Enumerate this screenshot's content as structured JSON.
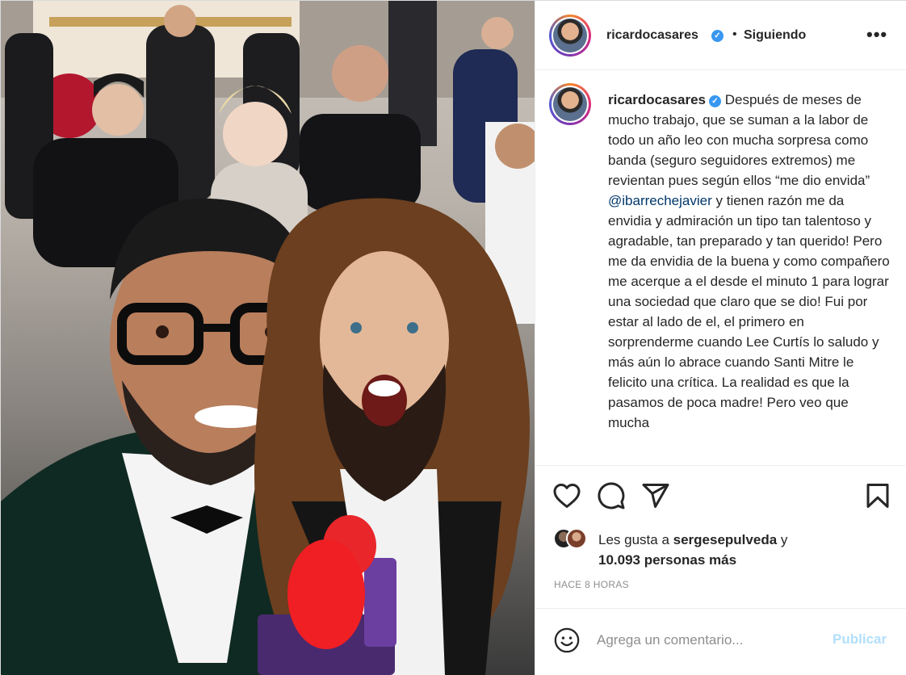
{
  "post": {
    "author": {
      "username": "ricardocasares",
      "verified": true,
      "follow_state": "Siguiendo"
    },
    "caption": {
      "text_before_mention": "Después de meses de mucho trabajo, que se suman a la labor de todo un año leo con mucha sorpresa como banda (seguro seguidores extremos) me revientan pues según ellos “me dio envida”",
      "mention": "@ibarrechejavier",
      "text_after_mention": "y tienen razón me da envidia y admiración un tipo tan talentoso y agradable, tan preparado y tan querido! Pero me da envidia de la buena y como compañero me acerque a el desde el minuto 1 para lograr una sociedad que claro que se dio! Fui por estar al lado de el, el primero en sorprenderme cuando Lee Curtís lo saludo y más aún lo abrace cuando Santi Mitre le felicito una crítica. La realidad es que la pasamos de poca madre! Pero veo que mucha"
    },
    "likes": {
      "prefix": "Les gusta a",
      "liker": "sergesepulveda",
      "joiner": "y",
      "others": "10.093 personas más"
    },
    "timestamp": "HACE 8 HORAS",
    "comment": {
      "placeholder": "Agrega un comentario...",
      "publish_label": "Publicar"
    }
  },
  "colors": {
    "verified_badge": "#3897f0",
    "mention_link": "#00376b",
    "publish_disabled": "#b2dffc",
    "muted_text": "#8e8e8e"
  },
  "icons": [
    "more-horizontal-icon",
    "heart-icon",
    "comment-icon",
    "share-icon",
    "bookmark-icon",
    "emoji-icon",
    "verified-icon"
  ]
}
